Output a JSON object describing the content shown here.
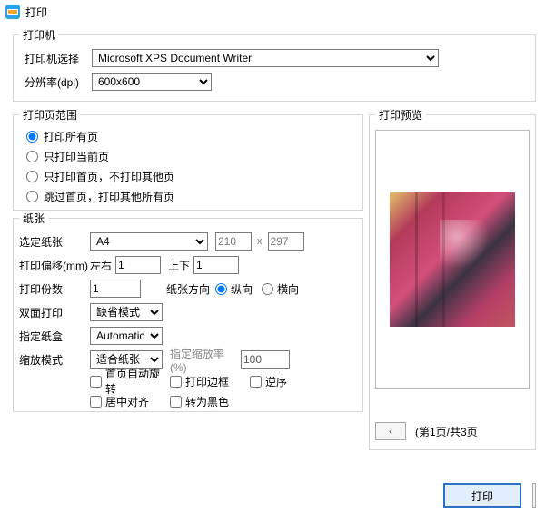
{
  "title": "打印",
  "printer": {
    "legend": "打印机",
    "select_label": "打印机选择",
    "selected": "Microsoft XPS Document Writer",
    "dpi_label": "分辨率(dpi)",
    "dpi": "600x600"
  },
  "range": {
    "legend": "打印页范围",
    "all": "打印所有页",
    "current": "只打印当前页",
    "first_only": "只打印首页，不打印其他页",
    "skip_first": "跳过首页，打印其他所有页"
  },
  "paper": {
    "legend": "纸张",
    "size_label": "选定纸张",
    "size": "A4",
    "width": "210",
    "x": "x",
    "height": "297",
    "offset_label": "打印偏移(mm)",
    "lr": "左右",
    "lr_val": "1",
    "tb": "上下",
    "tb_val": "1",
    "copies_label": "打印份数",
    "copies": "1",
    "orient_label": "纸张方向",
    "portrait": "纵向",
    "landscape": "横向",
    "duplex_label": "双面打印",
    "duplex": "缺省模式",
    "tray_label": "指定纸盒",
    "tray": "Automatic",
    "scale_mode_label": "缩放模式",
    "scale_mode": "适合纸张",
    "scale_pct_label": "指定缩放率(%)",
    "scale_pct": "100",
    "auto_rotate": "首页自动旋转",
    "border": "打印边框",
    "reverse": "逆序",
    "center": "居中对齐",
    "to_black": "转为黑色"
  },
  "preview": {
    "legend": "打印预览",
    "page_text": "(第1页/共3页"
  },
  "buttons": {
    "print": "打印"
  }
}
